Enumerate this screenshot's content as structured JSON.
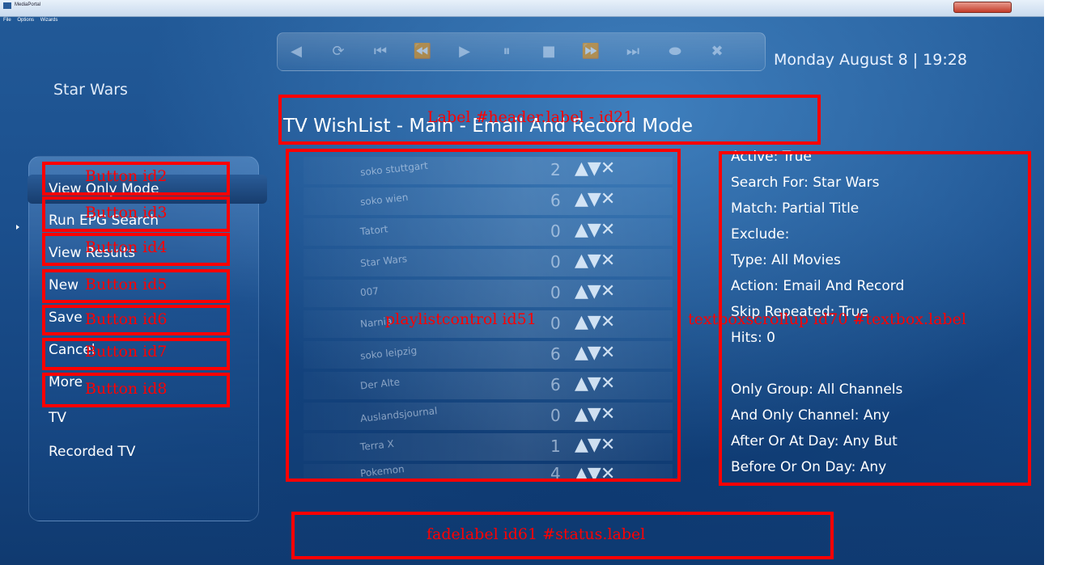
{
  "window": {
    "title": "MediaPortal",
    "menu": [
      "File",
      "Options",
      "Wizards"
    ]
  },
  "transport_icons": [
    "prev-icon",
    "refresh-icon",
    "skip-back-icon",
    "rewind-icon",
    "play-icon",
    "pause-icon",
    "stop-icon",
    "fast-forward-icon",
    "skip-forward-icon",
    "record-icon",
    "close-icon"
  ],
  "datetime": "Monday August 8 | 19:28",
  "subtitle": "Star Wars",
  "header": {
    "label": "TV WishList - Main - Email And Record Mode"
  },
  "menu": {
    "items": [
      {
        "label": "View Only Mode"
      },
      {
        "label": "Run EPG Search"
      },
      {
        "label": "View Results"
      },
      {
        "label": "New"
      },
      {
        "label": "Save"
      },
      {
        "label": "Cancel"
      },
      {
        "label": "More"
      },
      {
        "label": "TV"
      },
      {
        "label": "Recorded TV"
      }
    ]
  },
  "playlist": {
    "rows": [
      {
        "name": "soko stuttgart",
        "count": "2"
      },
      {
        "name": "soko wien",
        "count": "6"
      },
      {
        "name": "Tatort",
        "count": "0"
      },
      {
        "name": "Star Wars",
        "count": "0"
      },
      {
        "name": "007",
        "count": "0"
      },
      {
        "name": "Narnia",
        "count": "0"
      },
      {
        "name": "soko leipzig",
        "count": "6"
      },
      {
        "name": "Der Alte",
        "count": "6"
      },
      {
        "name": "Auslandsjournal",
        "count": "0"
      },
      {
        "name": "Terra X",
        "count": "1"
      },
      {
        "name": "Pokemon",
        "count": "4"
      }
    ],
    "arrows": "▲▼✕"
  },
  "details": {
    "lines": [
      "Active: True",
      "Search For: Star Wars",
      "Match: Partial Title",
      "Exclude:",
      "Type: All Movies",
      "Action: Email And Record",
      "Skip Repeated: True",
      "Hits: 0",
      "",
      "Only Group: All Channels",
      "And Only Channel: Any",
      "After Or At Day: Any But",
      "Before Or On Day: Any"
    ]
  },
  "annotations": {
    "header": "Label #header.label - id21",
    "button2": "Button id2",
    "button3": "Button id3",
    "button4": "Button id4",
    "button5": "Button id5",
    "button6": "Button id6",
    "button7": "Button id7",
    "button8": "Button id8",
    "playlist": "playlistcontrol id51",
    "textbox": "textboxscrollup id70 #textbox.label",
    "status": "fadelabel id61 #status.label",
    "color": "#ff0000"
  }
}
